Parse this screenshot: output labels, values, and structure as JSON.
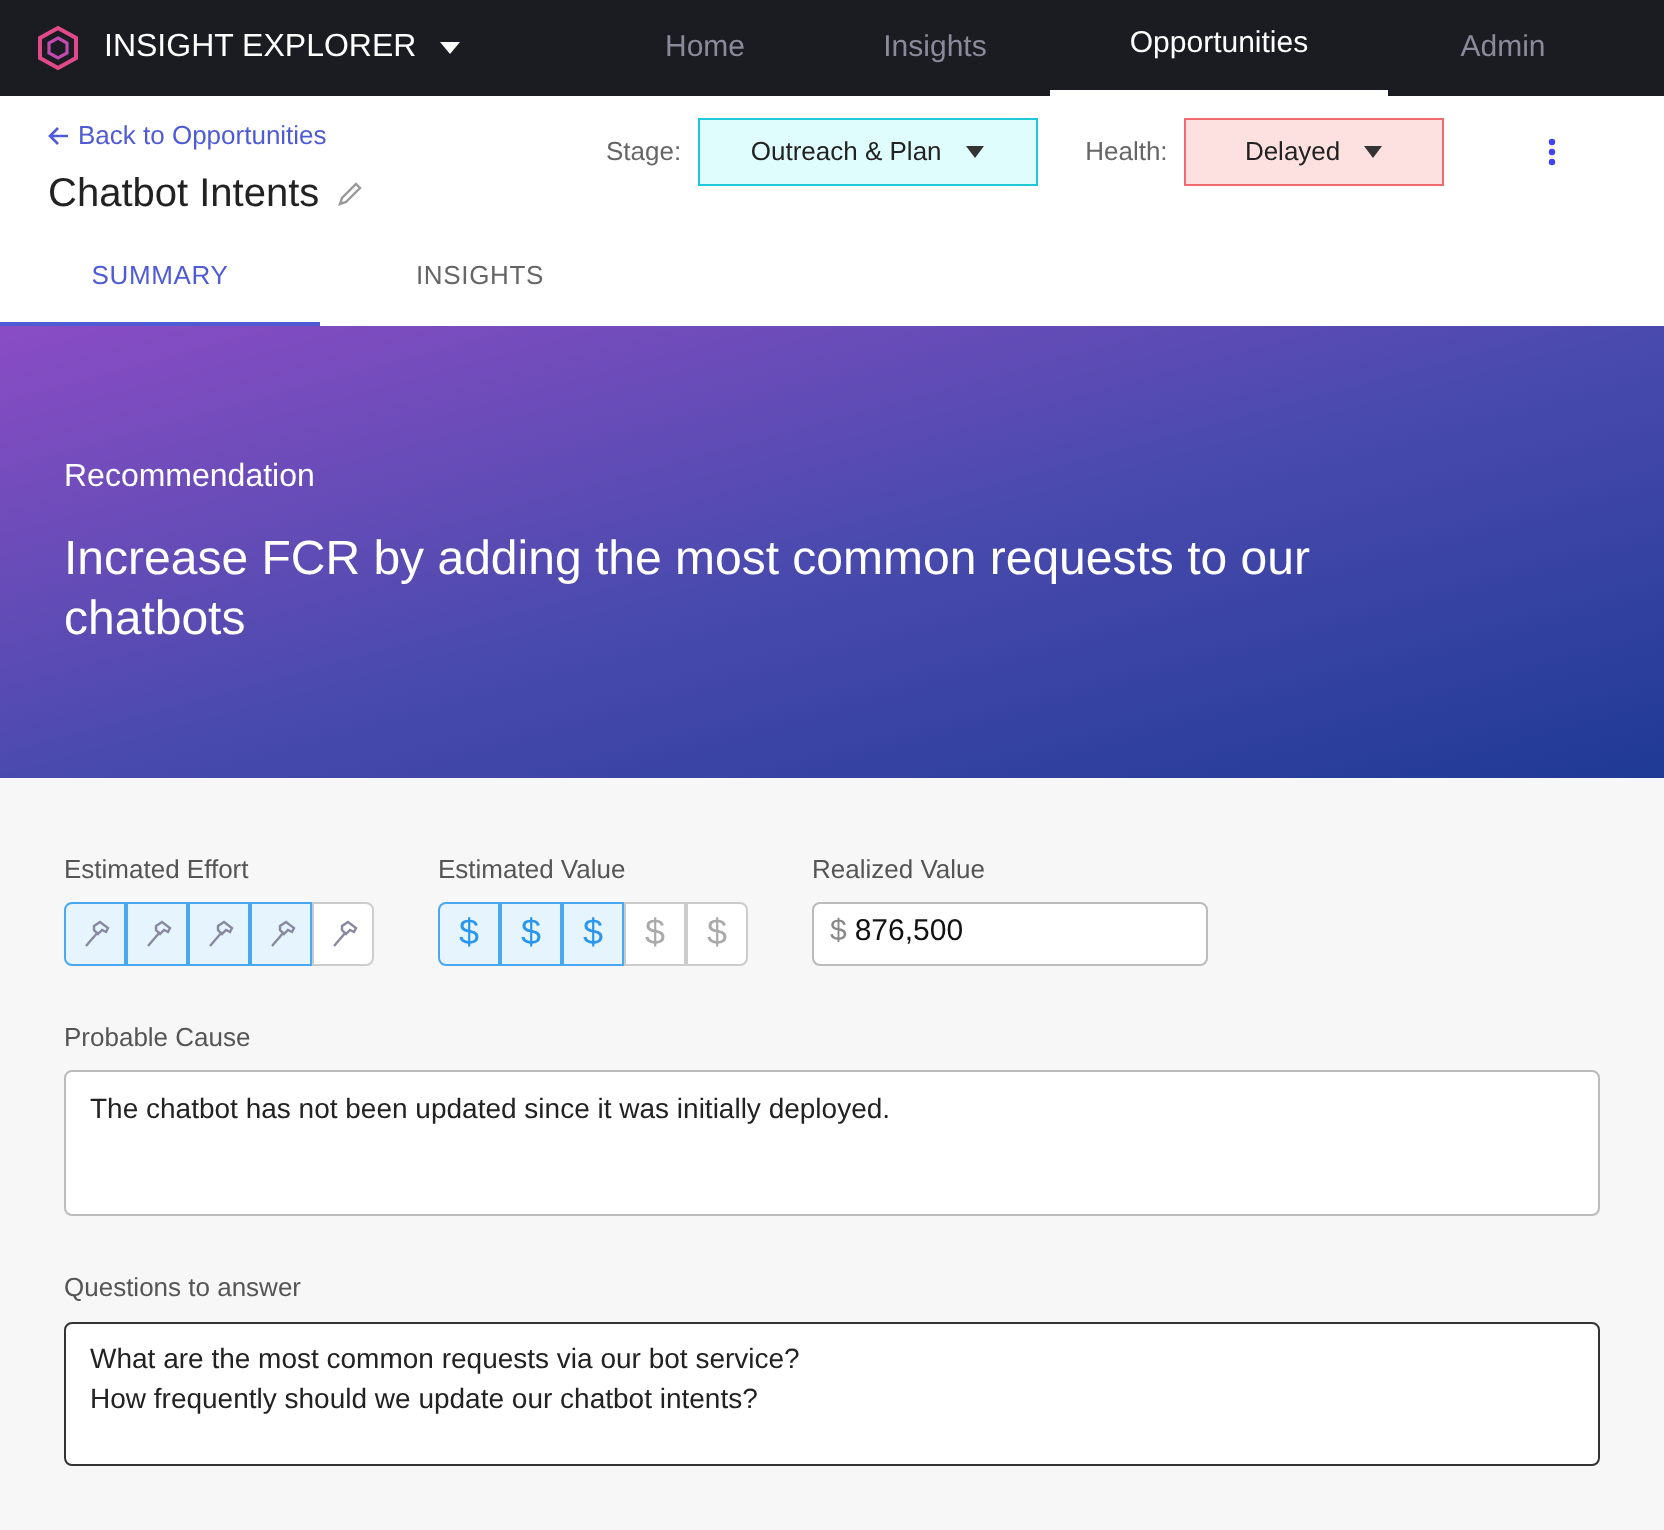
{
  "app": {
    "title": "INSIGHT EXPLORER"
  },
  "nav": [
    {
      "label": "Home",
      "selected": false
    },
    {
      "label": "Insights",
      "selected": false
    },
    {
      "label": "Opportunities",
      "selected": true
    },
    {
      "label": "Admin",
      "selected": false
    }
  ],
  "header": {
    "back_link": "Back to Opportunities",
    "title": "Chatbot Intents",
    "stage_label": "Stage:",
    "stage": "Outreach & Plan",
    "health_label": "Health:",
    "health": "Delayed"
  },
  "tabs": [
    {
      "label": "SUMMARY",
      "selected": true
    },
    {
      "label": "INSIGHTS",
      "selected": false
    }
  ],
  "banner": {
    "label": "Recommendation",
    "text": "Increase FCR by adding the most common requests to our chatbots"
  },
  "effort": {
    "label": "Estimated Effort",
    "segments": [
      {
        "selected": true
      },
      {
        "selected": true
      },
      {
        "selected": true
      },
      {
        "selected": true
      },
      {
        "selected": false
      }
    ]
  },
  "value": {
    "label": "Estimated Value",
    "segments": [
      {
        "symbol": "$",
        "selected": true
      },
      {
        "symbol": "$",
        "selected": true
      },
      {
        "symbol": "$",
        "selected": true
      },
      {
        "symbol": "$",
        "selected": false
      },
      {
        "symbol": "$",
        "selected": false
      }
    ]
  },
  "realized": {
    "label": "Realized Value",
    "prefix": "$",
    "value": "876,500"
  },
  "probable_cause": {
    "label": "Probable Cause",
    "value": "The chatbot has not been updated since it was initially deployed."
  },
  "questions": {
    "label": "Questions to answer",
    "lines": [
      "What are the most common requests via our bot service?",
      "How frequently should we update our chatbot intents?"
    ]
  }
}
